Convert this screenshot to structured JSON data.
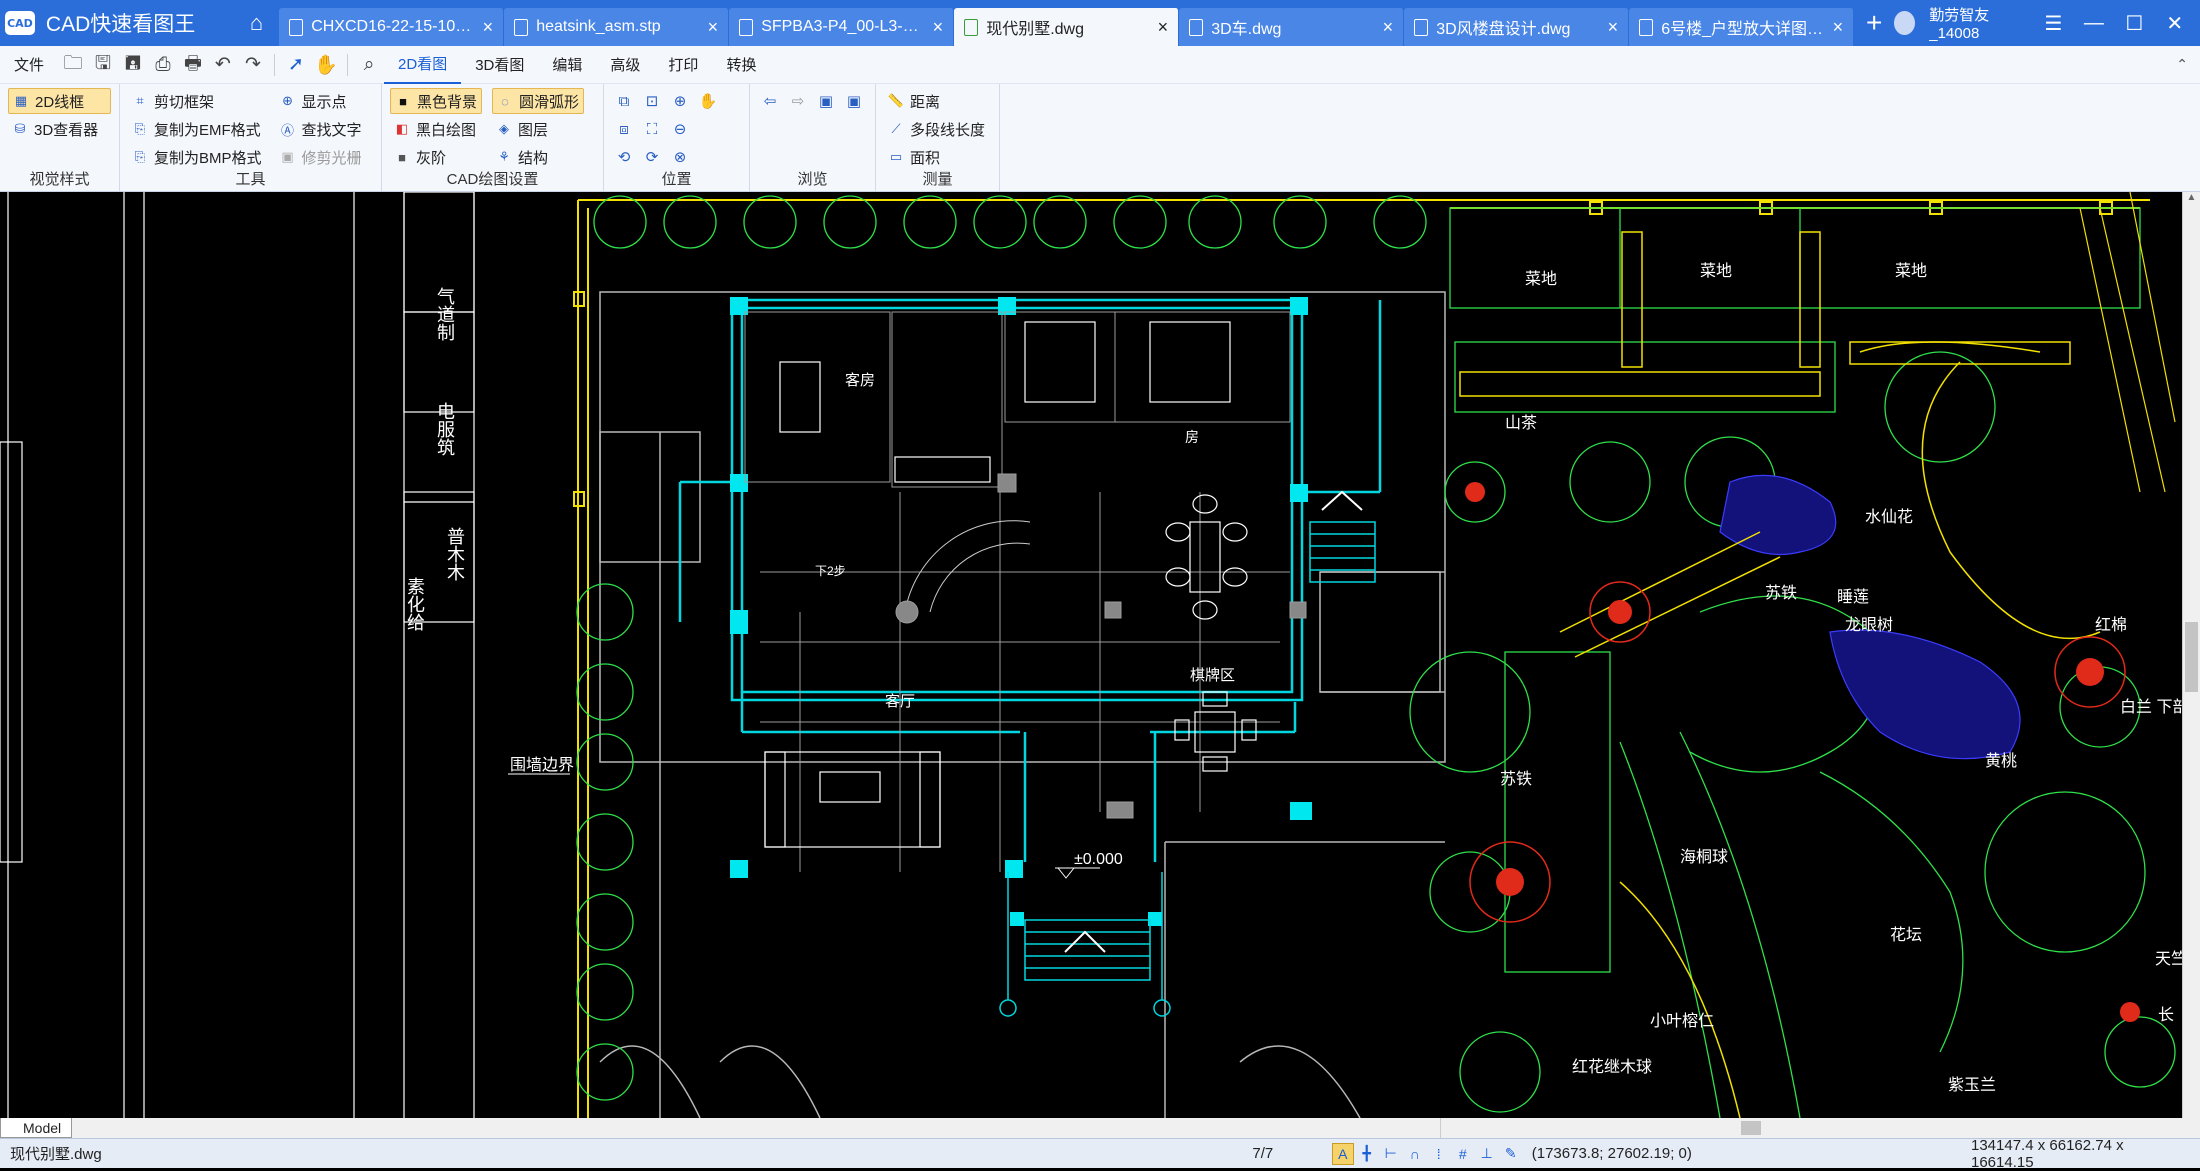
{
  "app": {
    "title": "CAD快速看图王",
    "logo_text": "CAD"
  },
  "tabs": [
    {
      "label": "CHXCD16-22-15-10-1...",
      "active": false
    },
    {
      "label": "heatsink_asm.stp",
      "active": false
    },
    {
      "label": "SFPBA3-P4_00-L3-B3.i...",
      "active": false
    },
    {
      "label": "现代别墅.dwg",
      "active": true
    },
    {
      "label": "3D车.dwg",
      "active": false
    },
    {
      "label": "3D风楼盘设计.dwg",
      "active": false
    },
    {
      "label": "6号楼_户型放大详图_t8...",
      "active": false
    }
  ],
  "user": {
    "name": "勤劳智友_14008"
  },
  "menu": {
    "file": "文件",
    "tabs": [
      "2D看图",
      "3D看图",
      "编辑",
      "高级",
      "打印",
      "转换"
    ],
    "active_tab": "2D看图"
  },
  "ribbon": {
    "visual_style": {
      "label": "视觉样式",
      "items": [
        "2D线框",
        "3D查看器"
      ]
    },
    "tools": {
      "label": "工具",
      "items": [
        "剪切框架",
        "复制为EMF格式",
        "复制为BMP格式",
        "显示点",
        "查找文字",
        "修剪光栅"
      ]
    },
    "cad_settings": {
      "label": "CAD绘图设置",
      "items": [
        "黑色背景",
        "黑白绘图",
        "灰阶",
        "圆滑弧形",
        "图层",
        "结构"
      ]
    },
    "position": {
      "label": "位置"
    },
    "browse": {
      "label": "浏览"
    },
    "measure": {
      "label": "测量",
      "items": [
        "距离",
        "多段线长度",
        "面积"
      ]
    }
  },
  "drawing": {
    "rooms": {
      "guest_room": "客房",
      "living_room": "客厅",
      "chess_area": "棋牌区",
      "room": "房",
      "down": "下2步",
      "elevation": "±0.000",
      "wall_border": "围墙边界"
    },
    "plants": {
      "vegetable1": "菜地",
      "vegetable2": "菜地",
      "vegetable3": "菜地",
      "camellia": "山茶",
      "sago": "苏铁",
      "sago2": "苏铁",
      "lotus": "睡莲",
      "longan": "龙眼树",
      "kapok": "红棉",
      "yulan": "白兰 下部比",
      "yellow": "黄桃",
      "dwarf": "海桐球",
      "magnolia": "紫玉兰",
      "ruby": "红花继木球",
      "banyan": "小叶榕仁",
      "tianzhu": "天竺",
      "long": "长",
      "shuiyin": "水仙花",
      "tiao": "花坛"
    },
    "vertical_texts": [
      "气道制",
      "电服筑",
      "普木木",
      "素化给"
    ]
  },
  "model_tab": "Model",
  "status": {
    "file": "现代别墅.dwg",
    "pages": "7/7",
    "coords": "(173673.8; 27602.19; 0)",
    "size": "134147.4 x 66162.74 x 16614.15"
  }
}
